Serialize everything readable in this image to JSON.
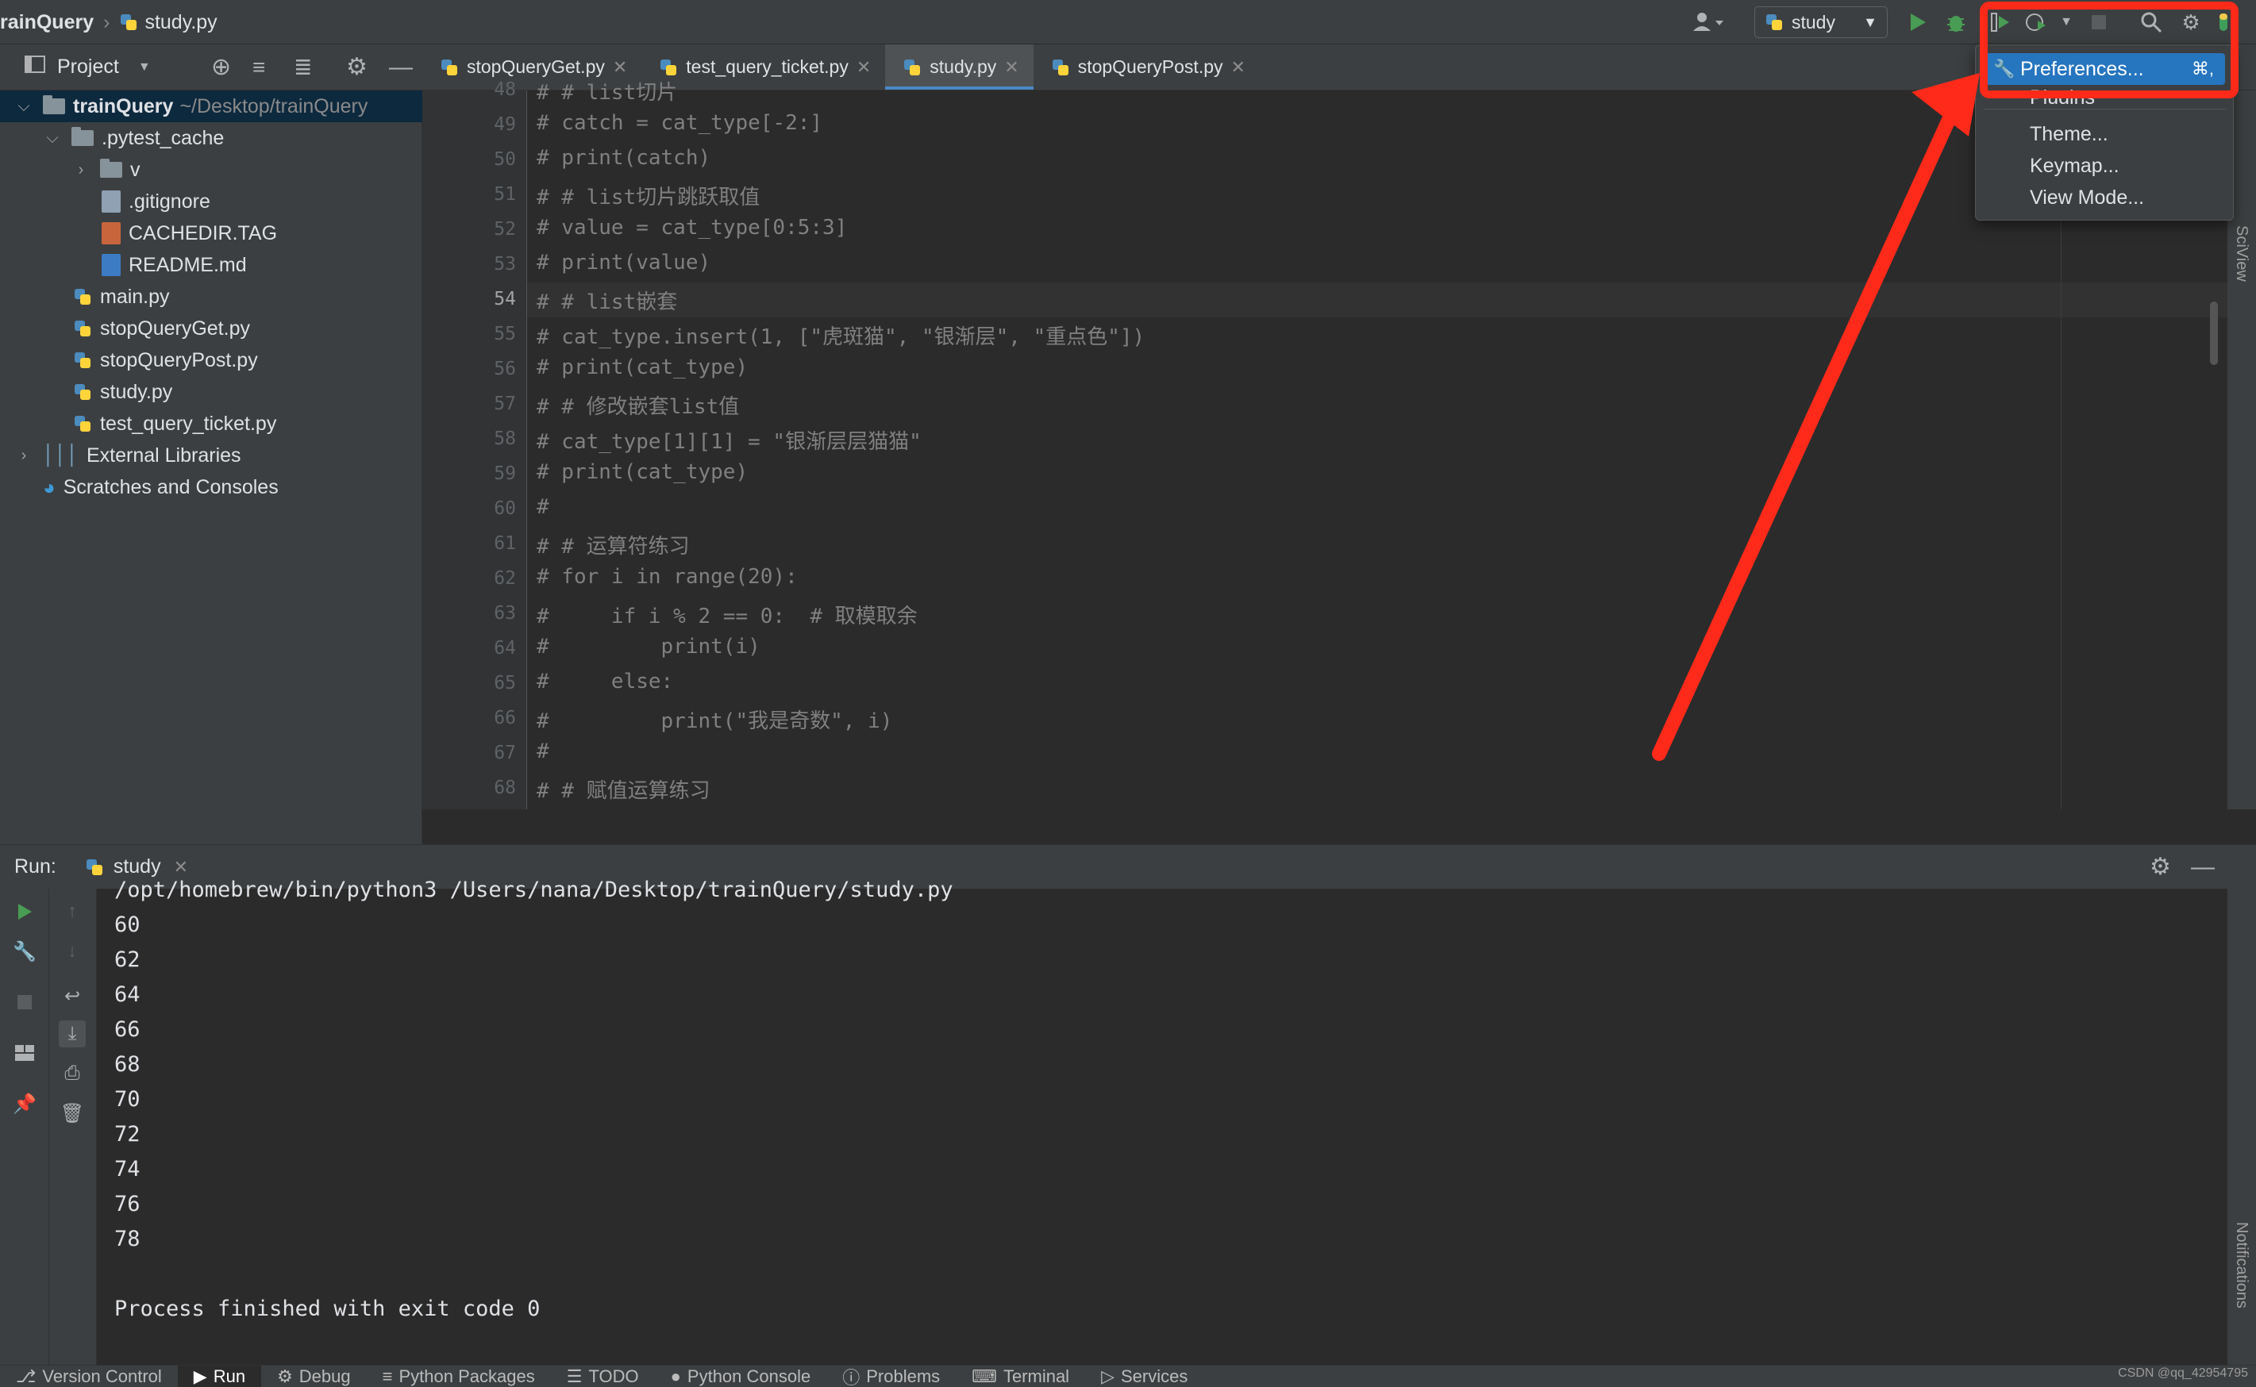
{
  "titlebar": {
    "project": "rainQuery",
    "separator": "›",
    "file": "study.py",
    "run_config": "study"
  },
  "project_panel": {
    "title": "Project",
    "tree": [
      {
        "label": "trainQuery",
        "hint": "~/Desktop/trainQuery",
        "arrow": "⌵"
      },
      {
        "label": ".pytest_cache",
        "arrow": "⌵"
      },
      {
        "label": "v",
        "arrow": "›"
      },
      {
        "label": ".gitignore"
      },
      {
        "label": "CACHEDIR.TAG"
      },
      {
        "label": "README.md"
      },
      {
        "label": "main.py"
      },
      {
        "label": "stopQueryGet.py"
      },
      {
        "label": "stopQueryPost.py"
      },
      {
        "label": "study.py"
      },
      {
        "label": "test_query_ticket.py"
      },
      {
        "label": "External Libraries",
        "arrow": "›"
      },
      {
        "label": "Scratches and Consoles"
      }
    ]
  },
  "editor": {
    "tabs": [
      {
        "label": "stopQueryGet.py"
      },
      {
        "label": "test_query_ticket.py"
      },
      {
        "label": "study.py"
      },
      {
        "label": "stopQueryPost.py"
      }
    ],
    "line_numbers": [
      "48",
      "49",
      "50",
      "51",
      "52",
      "53",
      "54",
      "55",
      "56",
      "57",
      "58",
      "59",
      "60",
      "61",
      "62",
      "63",
      "64",
      "65",
      "66",
      "67",
      "68"
    ],
    "lines": [
      "# # list切片",
      "# catch = cat_type[-2:]",
      "# print(catch)",
      "# # list切片跳跃取值",
      "# value = cat_type[0:5:3]",
      "# print(value)",
      "# # list嵌套",
      "# cat_type.insert(1, [\"虎斑猫\", \"银渐层\", \"重点色\"])",
      "# print(cat_type)",
      "# # 修改嵌套list值",
      "# cat_type[1][1] = \"银渐层层猫猫\"",
      "# print(cat_type)",
      "#",
      "# # 运算符练习",
      "# for i in range(20):",
      "#     if i % 2 == 0:  # 取模取余",
      "#         print(i)",
      "#     else:",
      "#         print(\"我是奇数\", i)",
      "#",
      "# # 赋值运算练习"
    ]
  },
  "popup_menu": {
    "items": [
      {
        "label": "Preferences...",
        "shortcut": "⌘,"
      },
      {
        "label": "Plugins"
      },
      {
        "label": "Theme..."
      },
      {
        "label": "Keymap..."
      },
      {
        "label": "View Mode..."
      }
    ]
  },
  "side_strips": {
    "sciview": "SciView",
    "notifications": "Notifications"
  },
  "run_panel": {
    "label": "Run:",
    "tab": "study",
    "command": "/opt/homebrew/bin/python3 /Users/nana/Desktop/trainQuery/study.py",
    "output": [
      "60",
      "62",
      "64",
      "66",
      "68",
      "70",
      "72",
      "74",
      "76",
      "78"
    ],
    "exit_message": "Process finished with exit code 0"
  },
  "statusbar": {
    "items": [
      {
        "label": "Version Control"
      },
      {
        "label": "Run"
      },
      {
        "label": "Debug"
      },
      {
        "label": "Python Packages"
      },
      {
        "label": "TODO"
      },
      {
        "label": "Python Console"
      },
      {
        "label": "Problems"
      },
      {
        "label": "Terminal"
      },
      {
        "label": "Services"
      }
    ],
    "watermark": "CSDN @qq_42954795"
  },
  "colors": {
    "accent": "#2675bf",
    "highlight": "#ff2a1a",
    "run_green": "#499c54"
  }
}
